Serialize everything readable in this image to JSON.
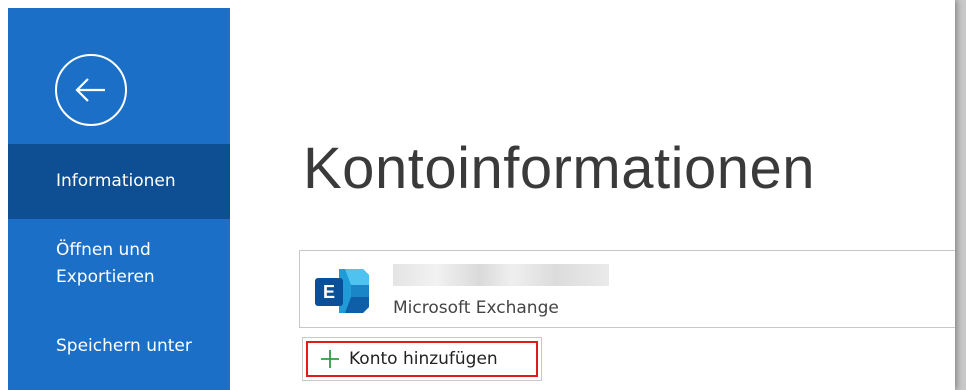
{
  "sidebar": {
    "back_button": "back-arrow-icon",
    "items": [
      {
        "label": "Informationen",
        "active": true
      },
      {
        "label": "Öffnen und\nExportieren",
        "active": false
      },
      {
        "label": "Speichern unter",
        "active": false
      }
    ]
  },
  "main": {
    "title": "Kontoinformationen",
    "account": {
      "type": "Microsoft Exchange",
      "icon": "exchange-logo-icon"
    },
    "add_account_label": "Konto hinzufügen"
  },
  "colors": {
    "sidebar": "#1b6fc6",
    "sidebar_active": "#0e4e93",
    "highlight": "#e01b1b",
    "plus": "#2e9e3a"
  }
}
